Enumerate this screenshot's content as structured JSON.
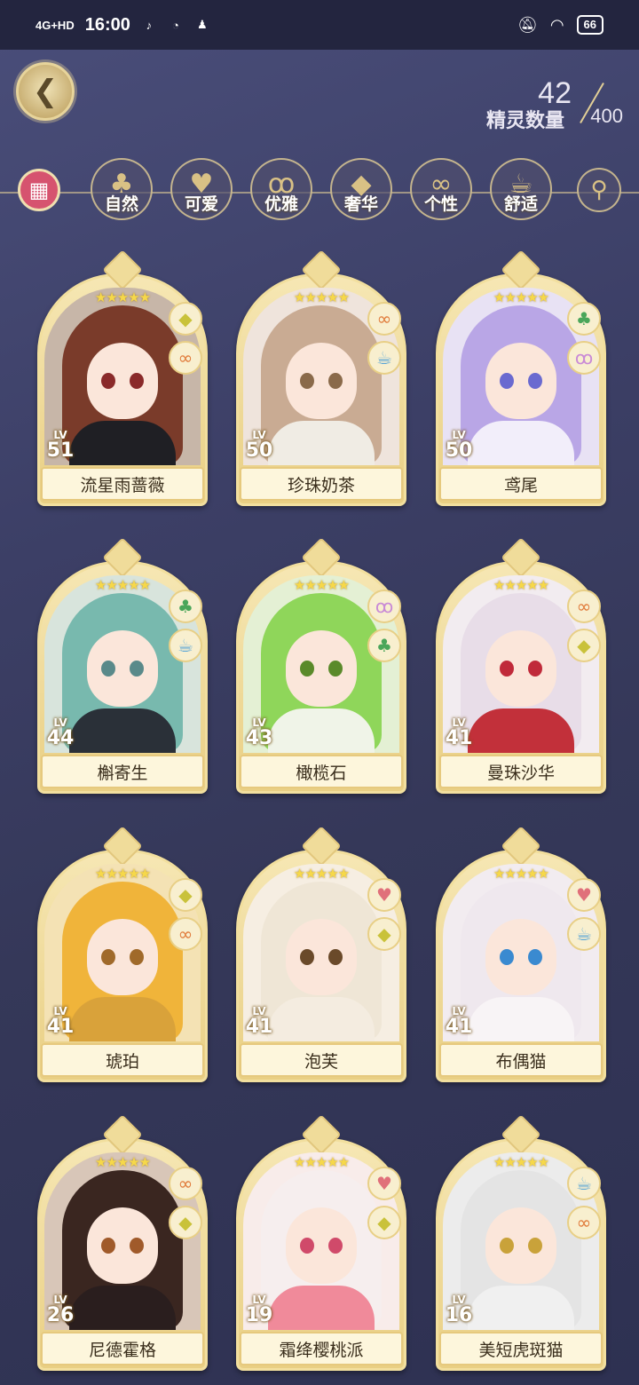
{
  "status_bar": {
    "network": "4G+HD",
    "time": "16:00",
    "app_icons": [
      "douyin-icon",
      "wechat-icon",
      "qq-icon"
    ],
    "battery": "66"
  },
  "header": {
    "back_icon": "back-arrow-icon",
    "spirit_count_label": "精灵数量",
    "spirit_count": "42",
    "spirit_max": "400"
  },
  "tabs": [
    {
      "icon": "all-grid-icon",
      "label": ""
    },
    {
      "icon": "clover-icon",
      "label": "自然"
    },
    {
      "icon": "heart-icon",
      "label": "可爱"
    },
    {
      "icon": "swan-icon",
      "label": "优雅"
    },
    {
      "icon": "diamond-icon",
      "label": "奢华"
    },
    {
      "icon": "glasses-icon",
      "label": "个性"
    },
    {
      "icon": "teacup-icon",
      "label": "舒适"
    },
    {
      "icon": "search-icon",
      "label": ""
    }
  ],
  "cards": [
    {
      "name": "流星雨蔷薇",
      "lv_label": "LV",
      "level": "51",
      "stars": 5,
      "badges": [
        "diamond-icon",
        "glasses-icon"
      ],
      "hair": "#7a3b2a",
      "eye": "#8a2a2a",
      "outfit": "#1f1f24",
      "bg": "#c7b6a8"
    },
    {
      "name": "珍珠奶茶",
      "lv_label": "LV",
      "level": "50",
      "stars": 5,
      "badges": [
        "glasses-icon",
        "teacup-icon"
      ],
      "hair": "#c9ab93",
      "eye": "#8a6a4a",
      "outfit": "#f0ece4",
      "bg": "#efe4dc"
    },
    {
      "name": "鸢尾",
      "lv_label": "LV",
      "level": "50",
      "stars": 5,
      "badges": [
        "clover-icon",
        "swan-icon"
      ],
      "hair": "#b9a6e6",
      "eye": "#6a6ad0",
      "outfit": "#f2eefa",
      "bg": "#e8e2f4"
    },
    {
      "name": "槲寄生",
      "lv_label": "LV",
      "level": "44",
      "stars": 5,
      "badges": [
        "clover-icon",
        "teacup-icon"
      ],
      "hair": "#78b9ae",
      "eye": "#5a8a8a",
      "outfit": "#2a3038",
      "bg": "#d8e4dc"
    },
    {
      "name": "橄榄石",
      "lv_label": "LV",
      "level": "43",
      "stars": 5,
      "badges": [
        "swan-icon",
        "clover-icon"
      ],
      "hair": "#8fd65a",
      "eye": "#5a8a2a",
      "outfit": "#f0f4e8",
      "bg": "#e4f0d4"
    },
    {
      "name": "曼珠沙华",
      "lv_label": "LV",
      "level": "41",
      "stars": 5,
      "badges": [
        "glasses-icon",
        "diamond-icon"
      ],
      "hair": "#e8dde8",
      "eye": "#c02a3a",
      "outfit": "#c2303a",
      "bg": "#f2ecf0"
    },
    {
      "name": "琥珀",
      "lv_label": "LV",
      "level": "41",
      "stars": 5,
      "badges": [
        "diamond-icon",
        "glasses-icon"
      ],
      "hair": "#f0b43a",
      "eye": "#a06a2a",
      "outfit": "#d9a23a",
      "bg": "#f4e2b4"
    },
    {
      "name": "泡芙",
      "lv_label": "LV",
      "level": "41",
      "stars": 5,
      "badges": [
        "heart-icon",
        "diamond-icon"
      ],
      "hair": "#efe6d6",
      "eye": "#6a4a2a",
      "outfit": "#f4ece0",
      "bg": "#f6eee2"
    },
    {
      "name": "布偶猫",
      "lv_label": "LV",
      "level": "41",
      "stars": 5,
      "badges": [
        "heart-icon",
        "teacup-icon"
      ],
      "hair": "#efe8ee",
      "eye": "#3a8ad0",
      "outfit": "#f8f4f6",
      "bg": "#f2ecf0"
    },
    {
      "name": "尼德霍格",
      "lv_label": "LV",
      "level": "26",
      "stars": 5,
      "badges": [
        "glasses-icon",
        "diamond-icon"
      ],
      "hair": "#3a2620",
      "eye": "#a05a2a",
      "outfit": "#2a1e1e",
      "bg": "#d8c6b8"
    },
    {
      "name": "霜绛樱桃派",
      "lv_label": "LV",
      "level": "19",
      "stars": 5,
      "badges": [
        "heart-icon",
        "diamond-icon"
      ],
      "hair": "#f6eeee",
      "eye": "#d04a6a",
      "outfit": "#f08a9a",
      "bg": "#f8ecea"
    },
    {
      "name": "美短虎斑猫",
      "lv_label": "LV",
      "level": "16",
      "stars": 5,
      "badges": [
        "teacup-icon",
        "glasses-icon"
      ],
      "hair": "#e4e4e4",
      "eye": "#c9a23a",
      "outfit": "#f0f0f0",
      "bg": "#ececec"
    }
  ],
  "colors": {
    "accent_gold": "#e9cf84",
    "active_tab": "#d6536f",
    "background": "#3c3f66"
  }
}
